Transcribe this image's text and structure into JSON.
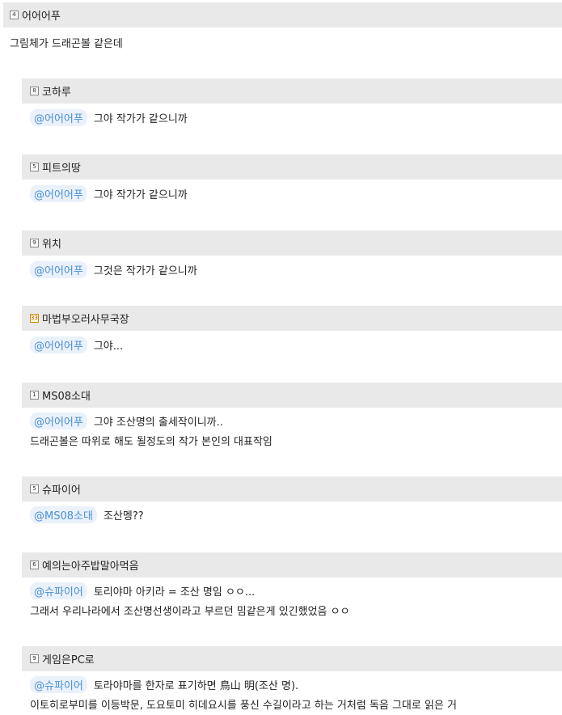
{
  "comments": [
    {
      "level": "4",
      "nickname": "어어어푸",
      "mention": "",
      "text": "그림체가 드래곤볼 같은데",
      "extra": ""
    },
    {
      "level": "8",
      "nickname": "코하루",
      "mention": "@어어어푸",
      "text": "그야 작가가 같으니까",
      "extra": ""
    },
    {
      "level": "5",
      "nickname": "피트의땅",
      "mention": "@어어어푸",
      "text": "그야 작가가 같으니까",
      "extra": ""
    },
    {
      "level": "9",
      "nickname": "위치",
      "mention": "@어어어푸",
      "text": "그것은 작가가 같으니까",
      "extra": ""
    },
    {
      "level": "33",
      "nickname": "마법부오러사무국장",
      "mention": "@어어어푸",
      "text": "그야...",
      "extra": ""
    },
    {
      "level": "1",
      "nickname": "MS08소대",
      "mention": "@어어어푸",
      "text": "그야 조산명의 출세작이니까..",
      "extra": "드래곤볼은 따위로 해도 될정도의 작가 본인의 대표작임"
    },
    {
      "level": "5",
      "nickname": "슈파이어",
      "mention": "@MS08소대",
      "text": "조산멩??",
      "extra": ""
    },
    {
      "level": "6",
      "nickname": "예의는아주밥말아먹음",
      "mention": "@슈파이어",
      "text": "토리야마 아키라 = 조산 명임 ㅇㅇ...",
      "extra": "그래서 우리나라에서 조산명선생이라고 부르던 밈같은게 있긴했었음 ㅇㅇ"
    },
    {
      "level": "9",
      "nickname": "게임은PC로",
      "mention": "@슈파이어",
      "text": "토라야마를 한자로 표기하면 鳥山 明(조산 명).",
      "extra": "이토히로부미를 이등박문, 도요토미 히데요시를 풍신 수길이라고 하는 거처럼 독음 그대로 읽은 거"
    }
  ]
}
